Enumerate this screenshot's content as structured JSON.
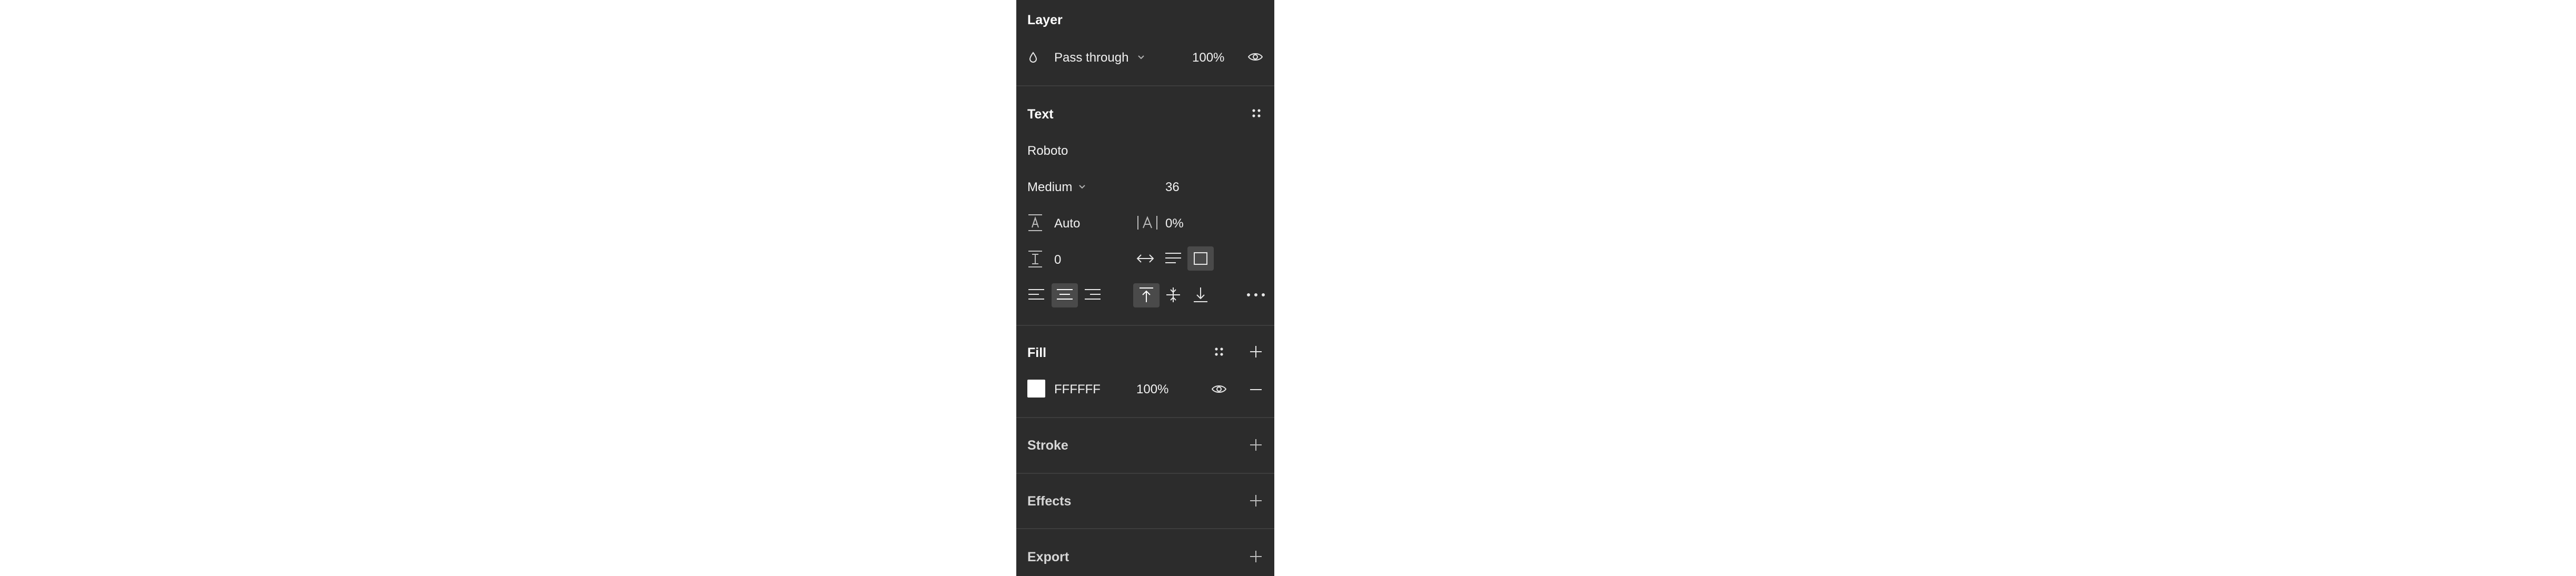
{
  "layer": {
    "title": "Layer",
    "blend_mode": "Pass through",
    "opacity": "100%"
  },
  "text": {
    "title": "Text",
    "font_family": "Roboto",
    "font_weight": "Medium",
    "font_size": "36",
    "line_height": "Auto",
    "letter_spacing": "0%",
    "paragraph_spacing": "0"
  },
  "fill": {
    "title": "Fill",
    "color_hex": "FFFFFF",
    "opacity": "100%",
    "swatch_color": "#ffffff"
  },
  "stroke": {
    "title": "Stroke"
  },
  "effects": {
    "title": "Effects"
  },
  "export": {
    "title": "Export"
  },
  "colors": {
    "panel_bg": "#2c2c2c",
    "divider": "#3d3d3d",
    "selected_bg": "#4a4a4a",
    "text": "#ffffff"
  }
}
